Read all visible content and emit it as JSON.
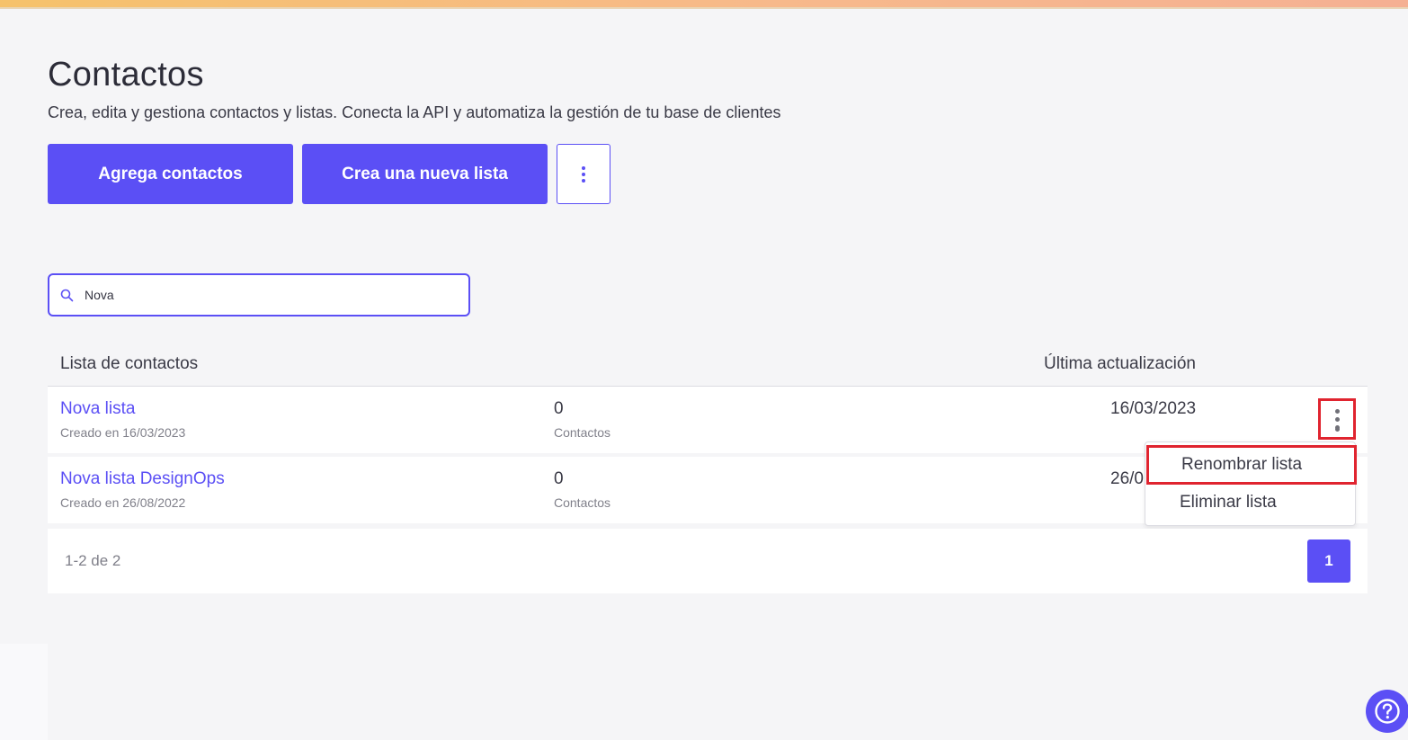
{
  "header": {
    "title": "Contactos",
    "subtitle": "Crea, edita y gestiona contactos y listas. Conecta la API y automatiza la gestión de tu base de clientes"
  },
  "toolbar": {
    "add_contacts_label": "Agrega contactos",
    "new_list_label": "Crea una nueva lista",
    "more_icon": "vertical-dots-icon"
  },
  "search": {
    "value": "Nova",
    "icon": "search-icon"
  },
  "table": {
    "columns": {
      "name": "Lista de contactos",
      "updated": "Última actualización"
    },
    "rows": [
      {
        "name": "Nova lista",
        "created": "Creado en 16/03/2023",
        "count": "0",
        "count_label": "Contactos",
        "updated": "16/03/2023"
      },
      {
        "name": "Nova lista DesignOps",
        "created": "Creado en 26/08/2022",
        "count": "0",
        "count_label": "Contactos",
        "updated": "26/0"
      }
    ]
  },
  "row_menu": {
    "rename_label": "Renombrar lista",
    "delete_label": "Eliminar lista"
  },
  "pagination": {
    "info": "1-2 de 2",
    "current_page": "1"
  },
  "colors": {
    "accent": "#5b4ff5",
    "highlight": "#e0242f",
    "background": "#f5f5f7"
  }
}
